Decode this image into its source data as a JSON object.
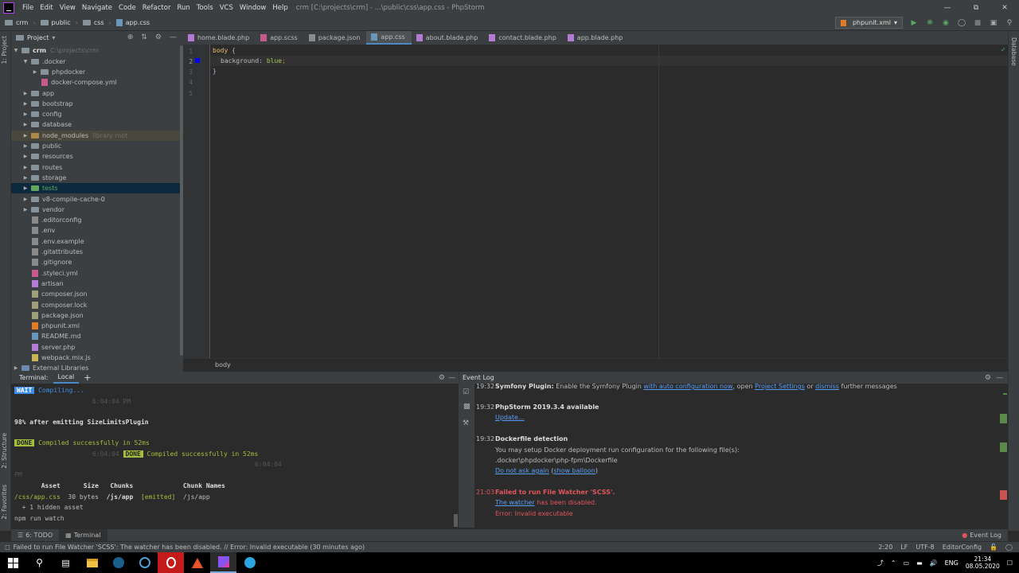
{
  "menu": {
    "items": [
      "File",
      "Edit",
      "View",
      "Navigate",
      "Code",
      "Refactor",
      "Run",
      "Tools",
      "VCS",
      "Window",
      "Help"
    ],
    "window_title": "crm [C:\\projects\\crm] - ...\\public\\css\\app.css - PhpStorm"
  },
  "navbar": {
    "crumbs": [
      "crm",
      "public",
      "css",
      "app.css"
    ],
    "run_config": "phpunit.xml"
  },
  "side_tabs": {
    "project": "1: Project",
    "structure": "2: Structure",
    "favorites": "2: Favorites",
    "database": "Database"
  },
  "project": {
    "header": "Project",
    "root_name": "crm",
    "root_path": "C:\\projects\\crm",
    "items": [
      {
        "name": ".docker",
        "type": "folder",
        "indent": 1,
        "arrow": "down",
        "extra": ""
      },
      {
        "name": "phpdocker",
        "type": "folder",
        "indent": 2,
        "arrow": "right",
        "extra": ""
      },
      {
        "name": "docker-compose.yml",
        "type": "file",
        "indent": 2,
        "arrow": "",
        "extra": ""
      },
      {
        "name": "app",
        "type": "folder",
        "indent": 1,
        "arrow": "right",
        "extra": ""
      },
      {
        "name": "bootstrap",
        "type": "folder",
        "indent": 1,
        "arrow": "right",
        "extra": ""
      },
      {
        "name": "config",
        "type": "folder",
        "indent": 1,
        "arrow": "right",
        "extra": ""
      },
      {
        "name": "database",
        "type": "folder",
        "indent": 1,
        "arrow": "right",
        "extra": ""
      },
      {
        "name": "node_modules",
        "type": "folder",
        "indent": 1,
        "arrow": "right",
        "extra": "library root"
      },
      {
        "name": "public",
        "type": "folder",
        "indent": 1,
        "arrow": "right",
        "extra": ""
      },
      {
        "name": "resources",
        "type": "folder",
        "indent": 1,
        "arrow": "right",
        "extra": ""
      },
      {
        "name": "routes",
        "type": "folder",
        "indent": 1,
        "arrow": "right",
        "extra": ""
      },
      {
        "name": "storage",
        "type": "folder",
        "indent": 1,
        "arrow": "right",
        "extra": ""
      },
      {
        "name": "tests",
        "type": "folder",
        "indent": 1,
        "arrow": "right",
        "extra": ""
      },
      {
        "name": "v8-compile-cache-0",
        "type": "folder",
        "indent": 1,
        "arrow": "right",
        "extra": ""
      },
      {
        "name": "vendor",
        "type": "folder",
        "indent": 1,
        "arrow": "right",
        "extra": ""
      },
      {
        "name": ".editorconfig",
        "type": "file",
        "indent": 1,
        "arrow": "",
        "extra": ""
      },
      {
        "name": ".env",
        "type": "file",
        "indent": 1,
        "arrow": "",
        "extra": ""
      },
      {
        "name": ".env.example",
        "type": "file",
        "indent": 1,
        "arrow": "",
        "extra": ""
      },
      {
        "name": ".gitattributes",
        "type": "file",
        "indent": 1,
        "arrow": "",
        "extra": ""
      },
      {
        "name": ".gitignore",
        "type": "file",
        "indent": 1,
        "arrow": "",
        "extra": ""
      },
      {
        "name": ".styleci.yml",
        "type": "file",
        "indent": 1,
        "arrow": "",
        "extra": ""
      },
      {
        "name": "artisan",
        "type": "file",
        "indent": 1,
        "arrow": "",
        "extra": ""
      },
      {
        "name": "composer.json",
        "type": "file",
        "indent": 1,
        "arrow": "",
        "extra": ""
      },
      {
        "name": "composer.lock",
        "type": "file",
        "indent": 1,
        "arrow": "",
        "extra": ""
      },
      {
        "name": "package.json",
        "type": "file",
        "indent": 1,
        "arrow": "",
        "extra": ""
      },
      {
        "name": "phpunit.xml",
        "type": "file",
        "indent": 1,
        "arrow": "",
        "extra": ""
      },
      {
        "name": "README.md",
        "type": "file",
        "indent": 1,
        "arrow": "",
        "extra": ""
      },
      {
        "name": "server.php",
        "type": "file",
        "indent": 1,
        "arrow": "",
        "extra": ""
      },
      {
        "name": "webpack.mix.js",
        "type": "file",
        "indent": 1,
        "arrow": "",
        "extra": ""
      },
      {
        "name": "External Libraries",
        "type": "lib",
        "indent": 0,
        "arrow": "right",
        "extra": ""
      }
    ]
  },
  "editor": {
    "tabs": [
      {
        "label": "home.blade.php",
        "color": "#b37ad6"
      },
      {
        "label": "app.scss",
        "color": "#c7598b"
      },
      {
        "label": "package.json",
        "color": "#8a8a8a"
      },
      {
        "label": "app.css",
        "color": "#6897bb"
      },
      {
        "label": "about.blade.php",
        "color": "#b37ad6"
      },
      {
        "label": "contact.blade.php",
        "color": "#b37ad6"
      },
      {
        "label": "app.blade.php",
        "color": "#b37ad6"
      }
    ],
    "active_tab": 3,
    "line_numbers": [
      "1",
      "2",
      "3",
      "4",
      "5"
    ],
    "code": {
      "l1_selector": "body",
      "l1_brace": " {",
      "l2_prop": "background",
      "l2_colon": ": ",
      "l2_value": "blue",
      "l2_semi": ";",
      "l3": "}"
    },
    "breadcrumb": "body"
  },
  "terminal": {
    "label": "Terminal:",
    "tab": "Local",
    "add": "+",
    "wait_badge": "WAIT",
    "compiling": "Compiling...",
    "time1": "6:04:04 PM",
    "emitting": "98% after emitting SizeLimitsPlugin",
    "done_badge": "DONE",
    "compiled": "Compiled successfully in 52ms",
    "time2": "6:04:04",
    "done_badge2": "DONE",
    "compiled2": "Compiled successfully in 52ms",
    "time3": "6:04:04",
    "pm": "PM",
    "table_header": "       Asset      Size   Chunks             Chunk Names",
    "asset": "/css/app.css",
    "asset_size": "  30 bytes  ",
    "asset_chunk": "/js/app",
    "asset_status": "[emitted]",
    "asset_name": "/js/app",
    "hidden": "  + 1 hidden asset",
    "command": "npm run watch"
  },
  "event_log": {
    "title": "Event Log",
    "entries": [
      {
        "time": "19:32",
        "title": "Symfony Plugin:",
        "text": " Enable the Symfony Plugin ",
        "link1": "with auto configuration now",
        "text2": ", open ",
        "link2": "Project Settings",
        "text3": " or ",
        "link3": "dismiss",
        "text4": " further messages"
      },
      {
        "time": "19:32",
        "title": "PhpStorm 2019.3.4 available",
        "link": "Update..."
      },
      {
        "time": "19:32",
        "title": "Dockerfile detection",
        "line1": "You may setup Docker deployment run configuration for the following file(s):",
        "line2": ".docker\\phpdocker\\php-fpm\\Dockerfile",
        "link1": "Do not ask again",
        "paren_open": " (",
        "link2": "show balloon",
        "paren_close": ")"
      },
      {
        "time": "21:03",
        "title": "Failed to run File Watcher 'SCSS'.",
        "link": "The watcher",
        "after_link": " has been disabled.",
        "line2": "Error: Invalid executable"
      }
    ]
  },
  "bottom_tabs": {
    "todo": "6: TODO",
    "terminal": "Terminal",
    "event_log": "Event Log"
  },
  "status": {
    "message": "Failed to run File Watcher 'SCSS': The watcher has been disabled. // Error: Invalid executable (30 minutes ago)",
    "position": "2:20",
    "line_sep": "LF",
    "encoding": "UTF-8",
    "config": "EditorConfig"
  },
  "taskbar": {
    "lang": "ENG",
    "time": "21:34",
    "date": "08.05.2020"
  }
}
